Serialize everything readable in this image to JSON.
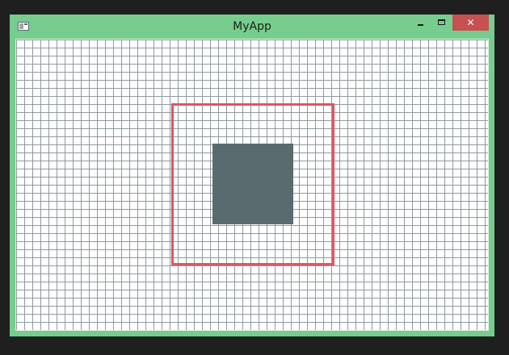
{
  "window": {
    "title": "MyApp",
    "close_glyph": "✕",
    "icons": {
      "app": "app-window-icon",
      "minimize": "minimize-icon",
      "maximize": "maximize-icon",
      "close": "close-icon"
    }
  },
  "canvas": {
    "grid_cell": 10,
    "colors": {
      "background": "#ffffff",
      "grid_line": "#8e9aa0",
      "frame_border": "#e05560",
      "square_fill": "#5a6b70",
      "window_chrome": "#77cd8d",
      "close_button": "#c75050"
    }
  }
}
